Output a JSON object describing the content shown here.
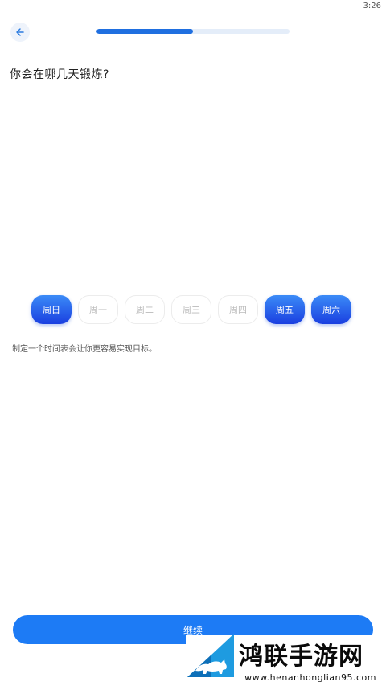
{
  "status": {
    "time": "3:26"
  },
  "header": {
    "progress": 0.5
  },
  "question": "你会在哪几天锻炼?",
  "days": [
    {
      "label": "周日",
      "selected": true
    },
    {
      "label": "周一",
      "selected": false
    },
    {
      "label": "周二",
      "selected": false
    },
    {
      "label": "周三",
      "selected": false
    },
    {
      "label": "周四",
      "selected": false
    },
    {
      "label": "周五",
      "selected": true
    },
    {
      "label": "周六",
      "selected": true
    }
  ],
  "hint": "制定一个时间表会让你更容易实现目标。",
  "continue_label": "继续",
  "watermark": {
    "title": "鸿联手游网",
    "url": "www.henanhonglian95.com"
  },
  "colors": {
    "accent": "#1d7bf5",
    "selected_top": "#3b8bf7",
    "selected_bottom": "#1a3fe0"
  }
}
